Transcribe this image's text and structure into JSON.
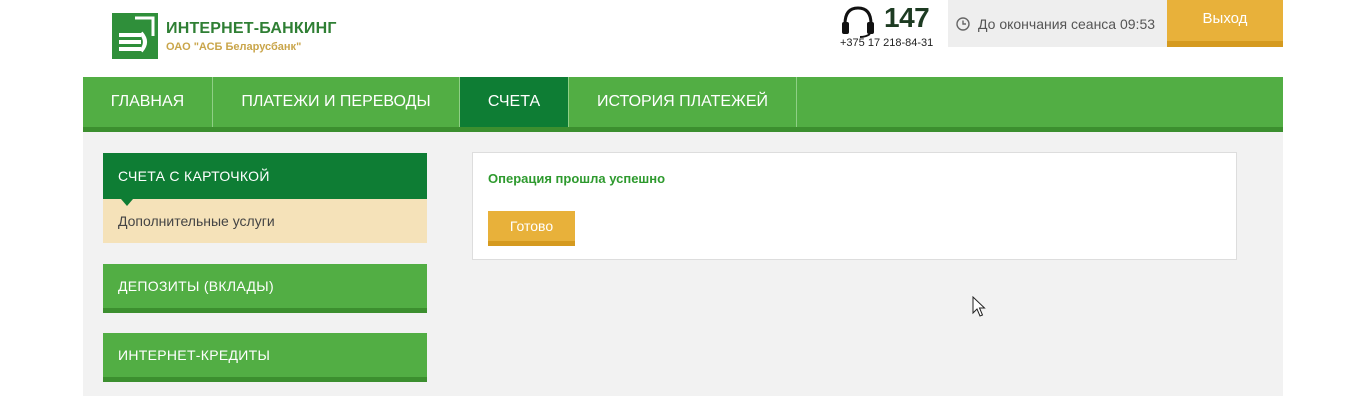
{
  "header": {
    "brand_title": "ИНТЕРНЕТ-БАНКИНГ",
    "brand_subtitle": "ОАО \"АСБ Беларусбанк\"",
    "logo_icon": "signal-stripes-logo",
    "phone_short": "147",
    "phone_full": "+375 17 218-84-31",
    "phone_icon": "headset-icon",
    "session_text": "До окончания сеанса 09:53",
    "session_icon": "clock-icon",
    "logout_label": "Выход"
  },
  "nav": {
    "items": [
      {
        "label": "ГЛАВНАЯ",
        "active": false
      },
      {
        "label": "ПЛАТЕЖИ И ПЕРЕВОДЫ",
        "active": false
      },
      {
        "label": "СЧЕТА",
        "active": true
      },
      {
        "label": "ИСТОРИЯ ПЛАТЕЖЕЙ",
        "active": false
      }
    ]
  },
  "sidebar": {
    "cards_account": "СЧЕТА С КАРТОЧКОЙ",
    "additional_services": "Дополнительные услуги",
    "deposits": "ДЕПОЗИТЫ (ВКЛАДЫ)",
    "credits": "ИНТЕРНЕТ-КРЕДИТЫ"
  },
  "main": {
    "success_message": "Операция прошла успешно",
    "done_label": "Готово"
  },
  "colors": {
    "green": "#52ae44",
    "dark_green": "#0e7d34",
    "gold": "#e8b13a",
    "beige": "#f5e2b9"
  }
}
